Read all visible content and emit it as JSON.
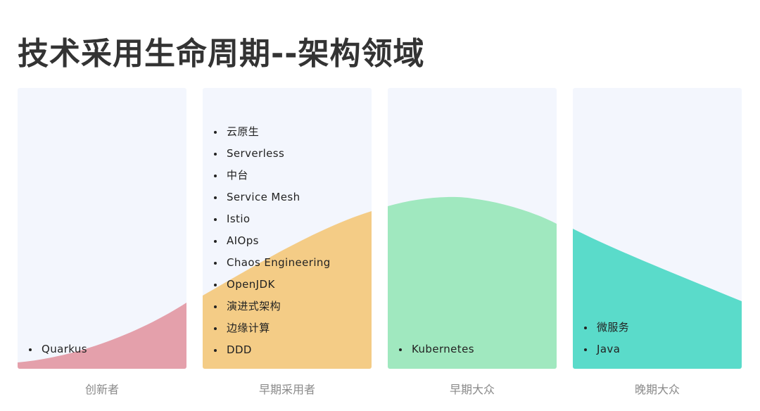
{
  "title": "技术采用生命周期--架构领域",
  "colors": {
    "panel_bg": "#f3f6fd",
    "innovators": "#e4a0ab",
    "early_adopters": "#f4cc86",
    "early_majority": "#a0e8bf",
    "late_majority": "#5adbca"
  },
  "stages": [
    {
      "label": "创新者",
      "items": [
        "Quarkus"
      ]
    },
    {
      "label": "早期采用者",
      "items": [
        "云原生",
        "Serverless",
        "中台",
        "Service Mesh",
        "Istio",
        "AIOps",
        "Chaos Engineering",
        "OpenJDK",
        "演进式架构",
        "边缘计算",
        "DDD"
      ]
    },
    {
      "label": "早期大众",
      "items": [
        "Kubernetes"
      ]
    },
    {
      "label": "晚期大众",
      "items": [
        "微服务",
        "Java"
      ]
    }
  ]
}
